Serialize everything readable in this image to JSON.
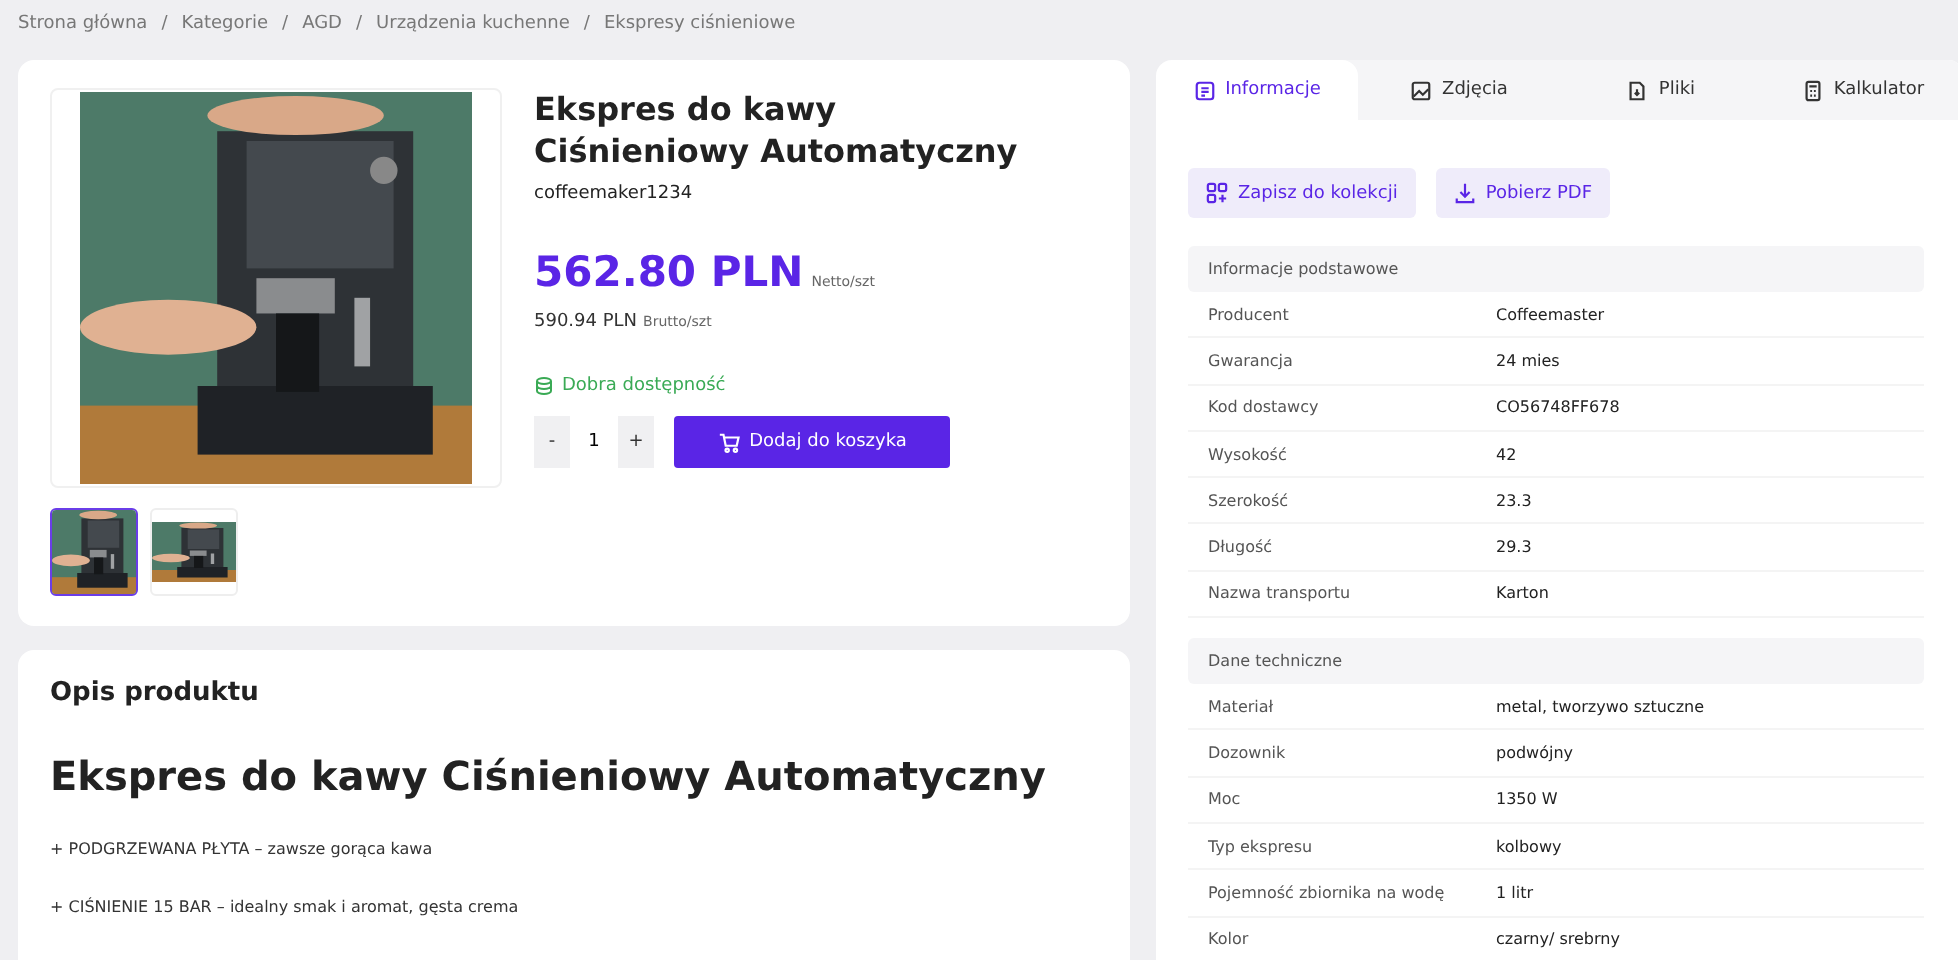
{
  "breadcrumb": [
    "Strona główna",
    "Kategorie",
    "AGD",
    "Urządzenia kuchenne",
    "Ekspresy ciśnieniowe"
  ],
  "breadcrumb_separator": "/",
  "product": {
    "title": "Ekspres do kawy Ciśnieniowy Automatyczny",
    "sku": "coffeemaker1234",
    "price_net": "562.80 PLN",
    "price_net_unit": "Netto/szt",
    "price_gross": "590.94 PLN",
    "price_gross_unit": "Brutto/szt",
    "availability": "Dobra dostępność",
    "quantity": {
      "minus": "-",
      "value": "1",
      "plus": "+"
    },
    "add_to_cart": "Dodaj do koszyka",
    "thumbnails": [
      {
        "kind": "picture",
        "selected": true
      },
      {
        "kind": "picture",
        "selected": false
      }
    ]
  },
  "description": {
    "heading": "Opis produktu",
    "title": "Ekspres do kawy Ciśnieniowy Automatyczny",
    "lines": [
      "+ PODGRZEWANA PŁYTA – zawsze gorąca kawa",
      "+ CIŚNIENIE 15 BAR – idealny smak i aromat, gęsta crema"
    ]
  },
  "tabs": [
    {
      "label": "Informacje",
      "selected": true
    },
    {
      "label": "Zdjęcia",
      "selected": false
    },
    {
      "label": "Pliki",
      "selected": false
    },
    {
      "label": "Kalkulator",
      "selected": false
    }
  ],
  "actions": [
    "Zapisz do kolekcji",
    "Pobierz PDF"
  ],
  "sections": [
    {
      "title": "Informacje podstawowe",
      "rows": [
        [
          "Producent",
          "Coffeemaster"
        ],
        [
          "Gwarancja",
          "24 mies"
        ],
        [
          "Kod dostawcy",
          "CO56748FF678"
        ],
        [
          "Wysokość",
          "42"
        ],
        [
          "Szerokość",
          "23.3"
        ],
        [
          "Długość",
          "29.3"
        ],
        [
          "Nazwa transportu",
          "Karton"
        ]
      ]
    },
    {
      "title": "Dane techniczne",
      "rows": [
        [
          "Materiał",
          "metal, tworzywo sztuczne"
        ],
        [
          "Dozownik",
          "podwójny"
        ],
        [
          "Moc",
          "1350 W"
        ],
        [
          "Typ ekspresu",
          "kolbowy"
        ],
        [
          "Pojemność zbiornika na wodę",
          "1 litr"
        ],
        [
          "Kolor",
          "czarny/ srebrny"
        ]
      ]
    }
  ]
}
